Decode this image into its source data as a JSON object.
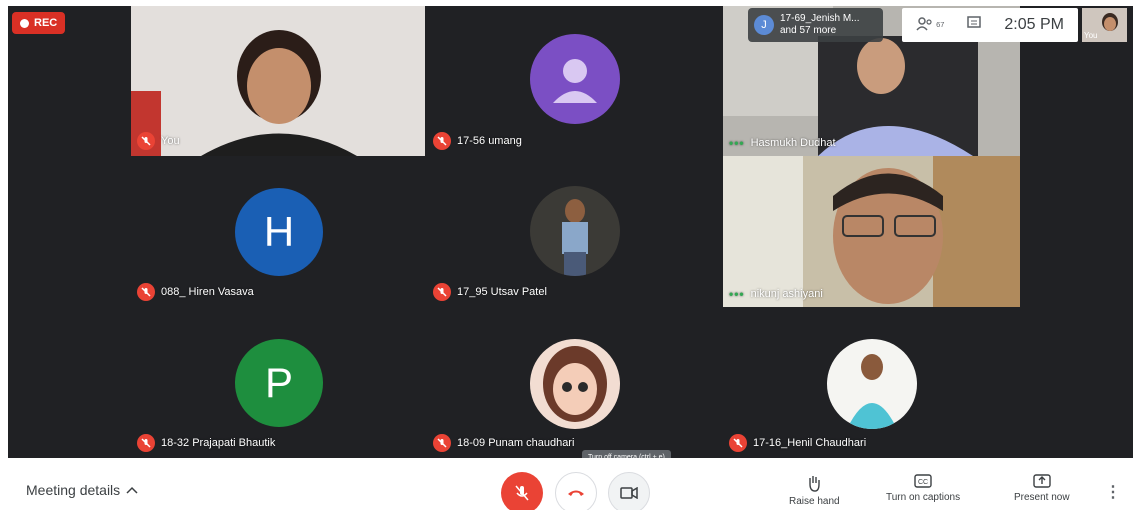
{
  "recording": {
    "label": "REC"
  },
  "presenting": {
    "initial": "J",
    "line1": "17-69_Jenish M...",
    "line2": "and 57 more"
  },
  "topbar": {
    "people_count": "67",
    "time": "2:05 PM"
  },
  "self_view": {
    "label": "You"
  },
  "tiles": [
    {
      "name": "You",
      "muted": true
    },
    {
      "name": "17-56 umang",
      "muted": true
    },
    {
      "name": "Hasmukh Dudhat",
      "muted": false
    },
    {
      "name": "088_ Hiren Vasava",
      "muted": true,
      "initial": "H",
      "color": "#1a5fb4"
    },
    {
      "name": "17_95 Utsav Patel",
      "muted": true
    },
    {
      "name": "nikunj ashiyani",
      "muted": false
    },
    {
      "name": "18-32 Prajapati Bhautik",
      "muted": true,
      "initial": "P",
      "color": "#1e8e3e"
    },
    {
      "name": "18-09 Punam chaudhari",
      "muted": true
    },
    {
      "name": "17-16_Henil Chaudhari",
      "muted": true
    }
  ],
  "bottom": {
    "meeting_details": "Meeting details",
    "tooltip": "Turn off camera (ctrl + e)",
    "raise_hand": "Raise hand",
    "captions": "Turn on captions",
    "present": "Present now"
  },
  "colors": {
    "accent_red": "#ea4335",
    "purple_avatar": "#7b4fc4"
  }
}
